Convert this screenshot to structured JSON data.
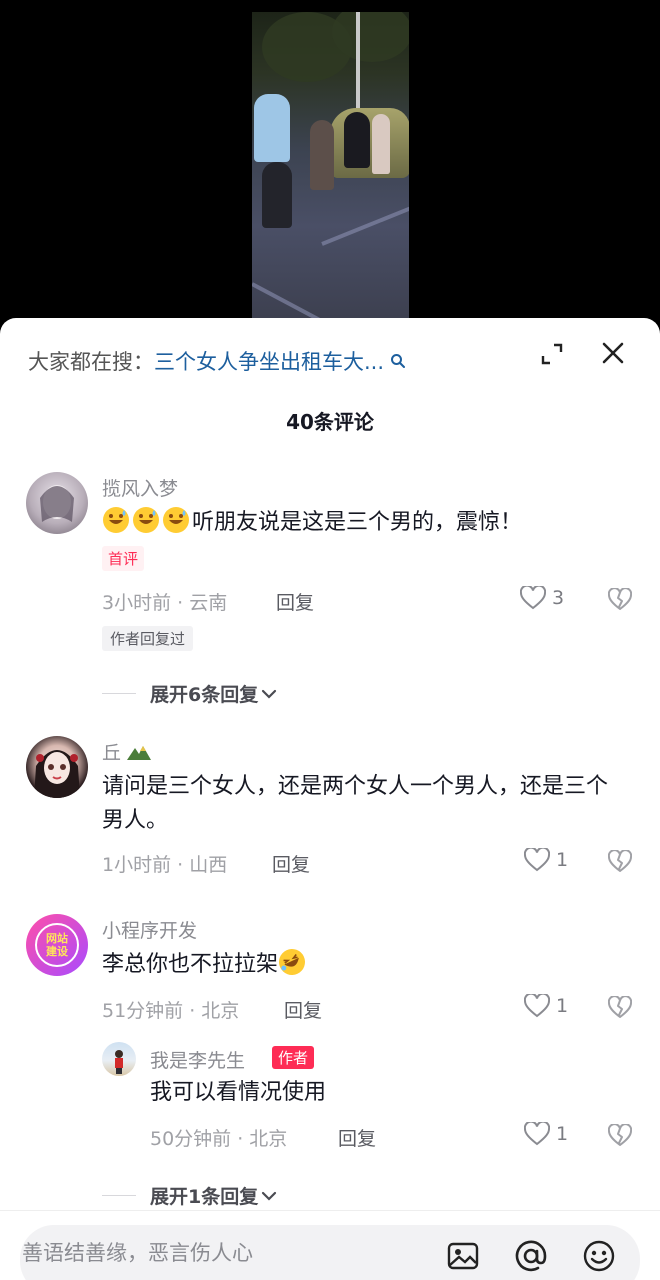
{
  "search": {
    "prefix": "大家都在搜：",
    "query": "三个女人争坐出租车大..."
  },
  "header": {
    "comment_count": "40条评论"
  },
  "comments": [
    {
      "username": "揽风入梦",
      "text": "听朋友说是这是三个男的，震惊！",
      "emojis": [
        "sweat-smile-emoji",
        "sweat-smile-emoji",
        "sweat-smile-emoji"
      ],
      "badge": "首评",
      "time_location": "3小时前 · 云南",
      "reply_label": "回复",
      "likes": "3",
      "author_tag": "作者回复过",
      "expand_label": "展开6条回复"
    },
    {
      "username": "丘",
      "text": "请问是三个女人，还是两个女人一个男人，还是三个男人。",
      "time_location": "1小时前 · 山西",
      "reply_label": "回复",
      "likes": "1"
    },
    {
      "username": "小程序开发",
      "avatar_text": "网站建设",
      "text": "李总你也不拉拉架",
      "emoji": "rofl-emoji",
      "time_location": "51分钟前 · 北京",
      "reply_label": "回复",
      "likes": "1",
      "reply": {
        "username": "我是李先生",
        "author_badge": "作者",
        "text": "我可以看情况使用",
        "time_location": "50分钟前 · 北京",
        "reply_label": "回复",
        "likes": "1"
      },
      "expand_label": "展开1条回复"
    }
  ],
  "input": {
    "placeholder": "善语结善缘，恶言伤人心"
  },
  "colors": {
    "accent": "#fe2c55",
    "link": "#1d5f9e",
    "text": "#161823",
    "muted": "#8a8b91"
  }
}
